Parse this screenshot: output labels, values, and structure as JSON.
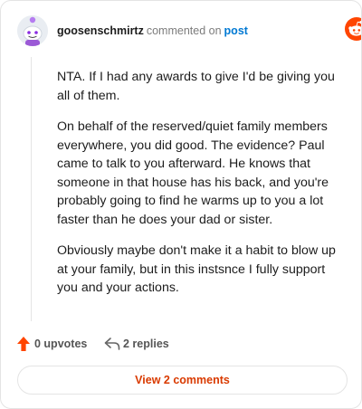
{
  "header": {
    "username": "goosenschmirtz",
    "commented_text": "commented on",
    "post_link": "post",
    "avatar_icon": "snoo-avatar-icon",
    "brand_icon": "reddit-logo-icon",
    "brand_text": "reddit",
    "colors": {
      "brand": "#ff4500",
      "link": "#0079d3"
    }
  },
  "comment": {
    "paragraphs": [
      "NTA. If I had any awards to give I'd be giving you all of them.",
      "On behalf of the reserved/quiet family members everywhere, you did good. The evidence? Paul came to talk to you afterward. He knows that someone in that house has his back, and you're probably going to find he warms up to you a lot faster than he does your dad or sister.",
      "Obviously maybe don't make it a habit to blow up at your family, but in this instsnce I fully support you and your actions."
    ]
  },
  "actions": {
    "upvote_icon": "upvote-arrow-icon",
    "upvotes": "0 upvotes",
    "reply_icon": "reply-icon",
    "replies": "2 replies",
    "colors": {
      "upvote": "#ff4500"
    }
  },
  "footer": {
    "view_button": "View 2 comments",
    "colors": {
      "button_text": "#d93a00"
    }
  }
}
